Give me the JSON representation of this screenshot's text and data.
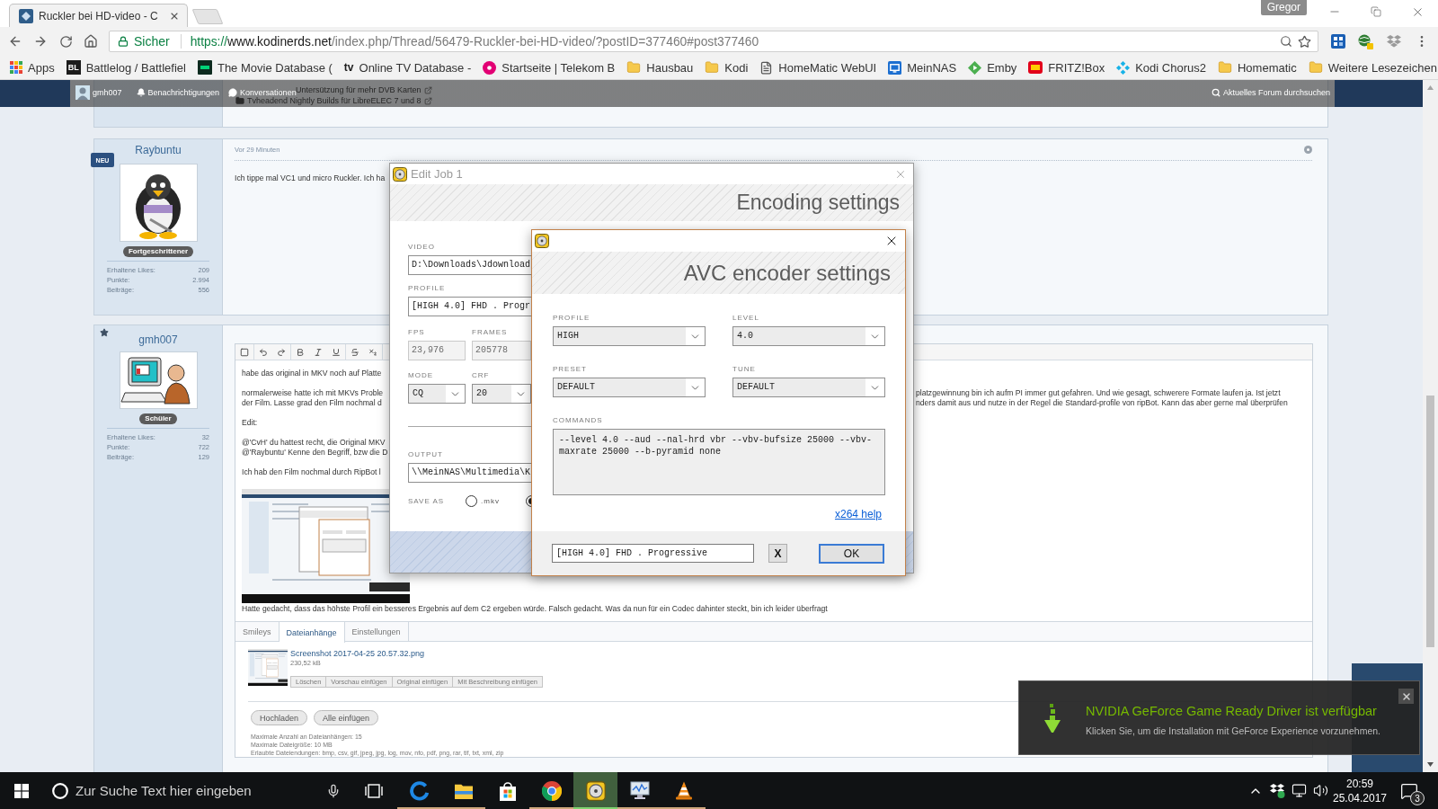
{
  "browser": {
    "tab": {
      "title": "Ruckler bei HD-video - C"
    },
    "profile": "Gregor",
    "address": {
      "security": "Sicher",
      "scheme": "https://",
      "host": "www.kodinerds.net",
      "path": "/index.php/Thread/56479-Ruckler-bei-HD-video/?postID=377460#post377460"
    },
    "bookmarks": [
      {
        "kind": "apps",
        "label": "Apps"
      },
      {
        "kind": "tile_letters",
        "icon_text": "BL",
        "label": "Battlelog / Battlefiel"
      },
      {
        "kind": "tile",
        "label": "The Movie Database ("
      },
      {
        "kind": "letters",
        "icon_text": "tv",
        "label": "Online TV Database -"
      },
      {
        "kind": "circle",
        "label": "Startseite | Telekom B"
      },
      {
        "kind": "folder",
        "label": "Hausbau"
      },
      {
        "kind": "folder",
        "label": "Kodi"
      },
      {
        "kind": "page",
        "label": "HomeMatic WebUI"
      },
      {
        "kind": "screen",
        "label": "MeinNAS"
      },
      {
        "kind": "play",
        "label": "Emby"
      },
      {
        "kind": "logo",
        "label": "FRITZ!Box"
      },
      {
        "kind": "diamond",
        "label": "Kodi Chorus2"
      },
      {
        "kind": "folder",
        "label": "Homematic"
      }
    ],
    "other_bookmarks": "Weitere Lesezeichen"
  },
  "forum": {
    "top_bar": {
      "user": "gmh007",
      "links": [
        {
          "kind": "bell",
          "label": "Benachrichtigungen"
        },
        {
          "kind": "chat",
          "label": "Konversationen"
        }
      ],
      "search": "Aktuelles Forum durchsuchen"
    },
    "previous_post": {
      "links": [
        "Untersützung für mehr DVB Karten",
        "Tvheadend Nightly Builds für LibreELEC 7 und 8"
      ]
    },
    "post": {
      "author": "Raybuntu",
      "badge": "NEU",
      "rank": "Fortgeschrittener",
      "stats": [
        {
          "label": "Erhaltene Likes:",
          "value": "209"
        },
        {
          "label": "Punkte:",
          "value": "2.994"
        },
        {
          "label": "Beiträge:",
          "value": "556"
        }
      ],
      "time": "Vor 29 Minuten",
      "text": "Ich tippe mal VC1 und micro Ruckler. Ich ha"
    },
    "reply": {
      "author": "gmh007",
      "starred": true,
      "rank": "Schüler",
      "stats": [
        {
          "label": "Erhaltene Likes:",
          "value": "32"
        },
        {
          "label": "Punkte:",
          "value": "722"
        },
        {
          "label": "Beiträge:",
          "value": "129"
        }
      ],
      "toolbar": [
        [
          {
            "kind": "source"
          }
        ],
        [
          {
            "kind": "undo"
          },
          {
            "kind": "redo"
          }
        ],
        [
          {
            "kind": "bold"
          },
          {
            "kind": "italic"
          },
          {
            "kind": "underline"
          }
        ],
        [
          {
            "kind": "strike"
          },
          {
            "kind": "subscript"
          }
        ]
      ],
      "body": [
        {
          "kind": "text",
          "lines": [
            {
              "left": "habe das original in MKV noch auf Platte"
            }
          ]
        },
        {
          "kind": "text",
          "lines": [
            {
              "left": "normalerweise hatte ich mit MKVs Proble",
              "right": "platzgewinnung bin ich aufm PI immer gut gefahren. Und wie gesagt, schwerere Formate laufen ja. Ist jetzt"
            },
            {
              "left": "der Film. Lasse grad den Film nochmal d",
              "right": "nders damit aus und nutze in der Regel die Standard-profile von ripBot. Kann das aber gerne mal überprüfen"
            }
          ]
        },
        {
          "kind": "text",
          "lines": [
            {
              "left": "Edit:"
            }
          ]
        },
        {
          "kind": "text",
          "lines": [
            {
              "left": "@'CvH' du hattest recht, die Original MKV"
            },
            {
              "left": "@'Raybuntu' Kenne den Begriff, bzw die D"
            }
          ]
        },
        {
          "kind": "text",
          "lines": [
            {
              "left": "Ich hab den Film nochmal durch RipBot l"
            }
          ]
        },
        {
          "kind": "image"
        },
        {
          "kind": "text",
          "lines": [
            {
              "left": "Hatte gedacht, dass das höhste Profil ein besseres Ergebnis auf dem C2 ergeben würde. Falsch gedacht. Was da nun für ein Codec dahinter steckt, bin ich leider überfragt"
            }
          ]
        }
      ],
      "tabs": [
        {
          "label": "Smileys",
          "selected": false
        },
        {
          "label": "Dateianhänge",
          "selected": true
        },
        {
          "label": "Einstellungen",
          "selected": false
        }
      ],
      "attachment": {
        "file": "Screenshot 2017-04-25 20.57.32.png",
        "size": "230,52 kB",
        "actions": [
          "Löschen",
          "Vorschau einfügen",
          "Original einfügen",
          "Mit Beschreibung einfügen"
        ]
      },
      "upload_buttons": [
        "Hochladen",
        "Alle einfügen"
      ],
      "limits": [
        "Maximale Anzahl an Dateianhängen: 15",
        "Maximale Dateigröße: 10 MB",
        "Erlaubte Dateiendungen: bmp, csv, gif, jpeg, jpg, log, mov, nfo, pdf, png, rar, tif, txt, xml, zip"
      ]
    }
  },
  "edit_job": {
    "title": "Edit Job 1",
    "header": "Encoding settings",
    "video": {
      "label": "VIDEO",
      "value": "D:\\Downloads\\Jdownload"
    },
    "profile": {
      "label": "PROFILE",
      "value": "[HIGH 4.0] FHD . Progr"
    },
    "fps": {
      "label": "FPS",
      "value": "23,976",
      "disabled": true
    },
    "frames": {
      "label": "FRAMES",
      "value": "205778",
      "disabled": true
    },
    "mode": {
      "label": "MODE",
      "value": "CQ"
    },
    "crf": {
      "label": "CRF",
      "value": "20"
    },
    "output": {
      "label": "OUTPUT",
      "value": "\\\\MeinNAS\\Multimedia\\K"
    },
    "save_as": {
      "label": "SAVE AS",
      "options": [
        {
          "label": ".mkv",
          "selected": false
        },
        {
          "selected": true
        }
      ]
    }
  },
  "avc_settings": {
    "header": "AVC encoder settings",
    "selects": [
      {
        "label": "PROFILE",
        "value": "HIGH"
      },
      {
        "label": "LEVEL",
        "value": "4.0"
      },
      {
        "label": "PRESET",
        "value": "DEFAULT"
      },
      {
        "label": "TUNE",
        "value": "DEFAULT"
      }
    ],
    "commands": {
      "label": "COMMANDS",
      "value": "--level 4.0 --aud --nal-hrd vbr --vbv-bufsize 25000 --vbv-maxrate 25000 --b-pyramid none"
    },
    "help_link": "x264 help",
    "preset_name": "[HIGH 4.0] FHD . Progressive",
    "clear_button": "X",
    "ok_button": "OK"
  },
  "notification": {
    "title": "NVIDIA GeForce Game Ready Driver ist verfügbar",
    "message": "Klicken Sie, um die Installation mit GeForce Experience vorzunehmen."
  },
  "taskbar": {
    "search_placeholder": "Zur Suche Text hier eingeben",
    "apps": [
      {
        "kind": "edge",
        "running": true,
        "active": false
      },
      {
        "kind": "explorer",
        "running": true,
        "active": false
      },
      {
        "kind": "store",
        "running": false,
        "active": false
      },
      {
        "kind": "chrome",
        "running": true,
        "active": false
      },
      {
        "kind": "ripbot",
        "running": true,
        "active": true
      },
      {
        "kind": "monitor",
        "running": true,
        "active": false
      },
      {
        "kind": "vlc",
        "running": true,
        "active": false
      }
    ],
    "time": "20:59",
    "date": "25.04.2017",
    "notification_count": "3"
  }
}
